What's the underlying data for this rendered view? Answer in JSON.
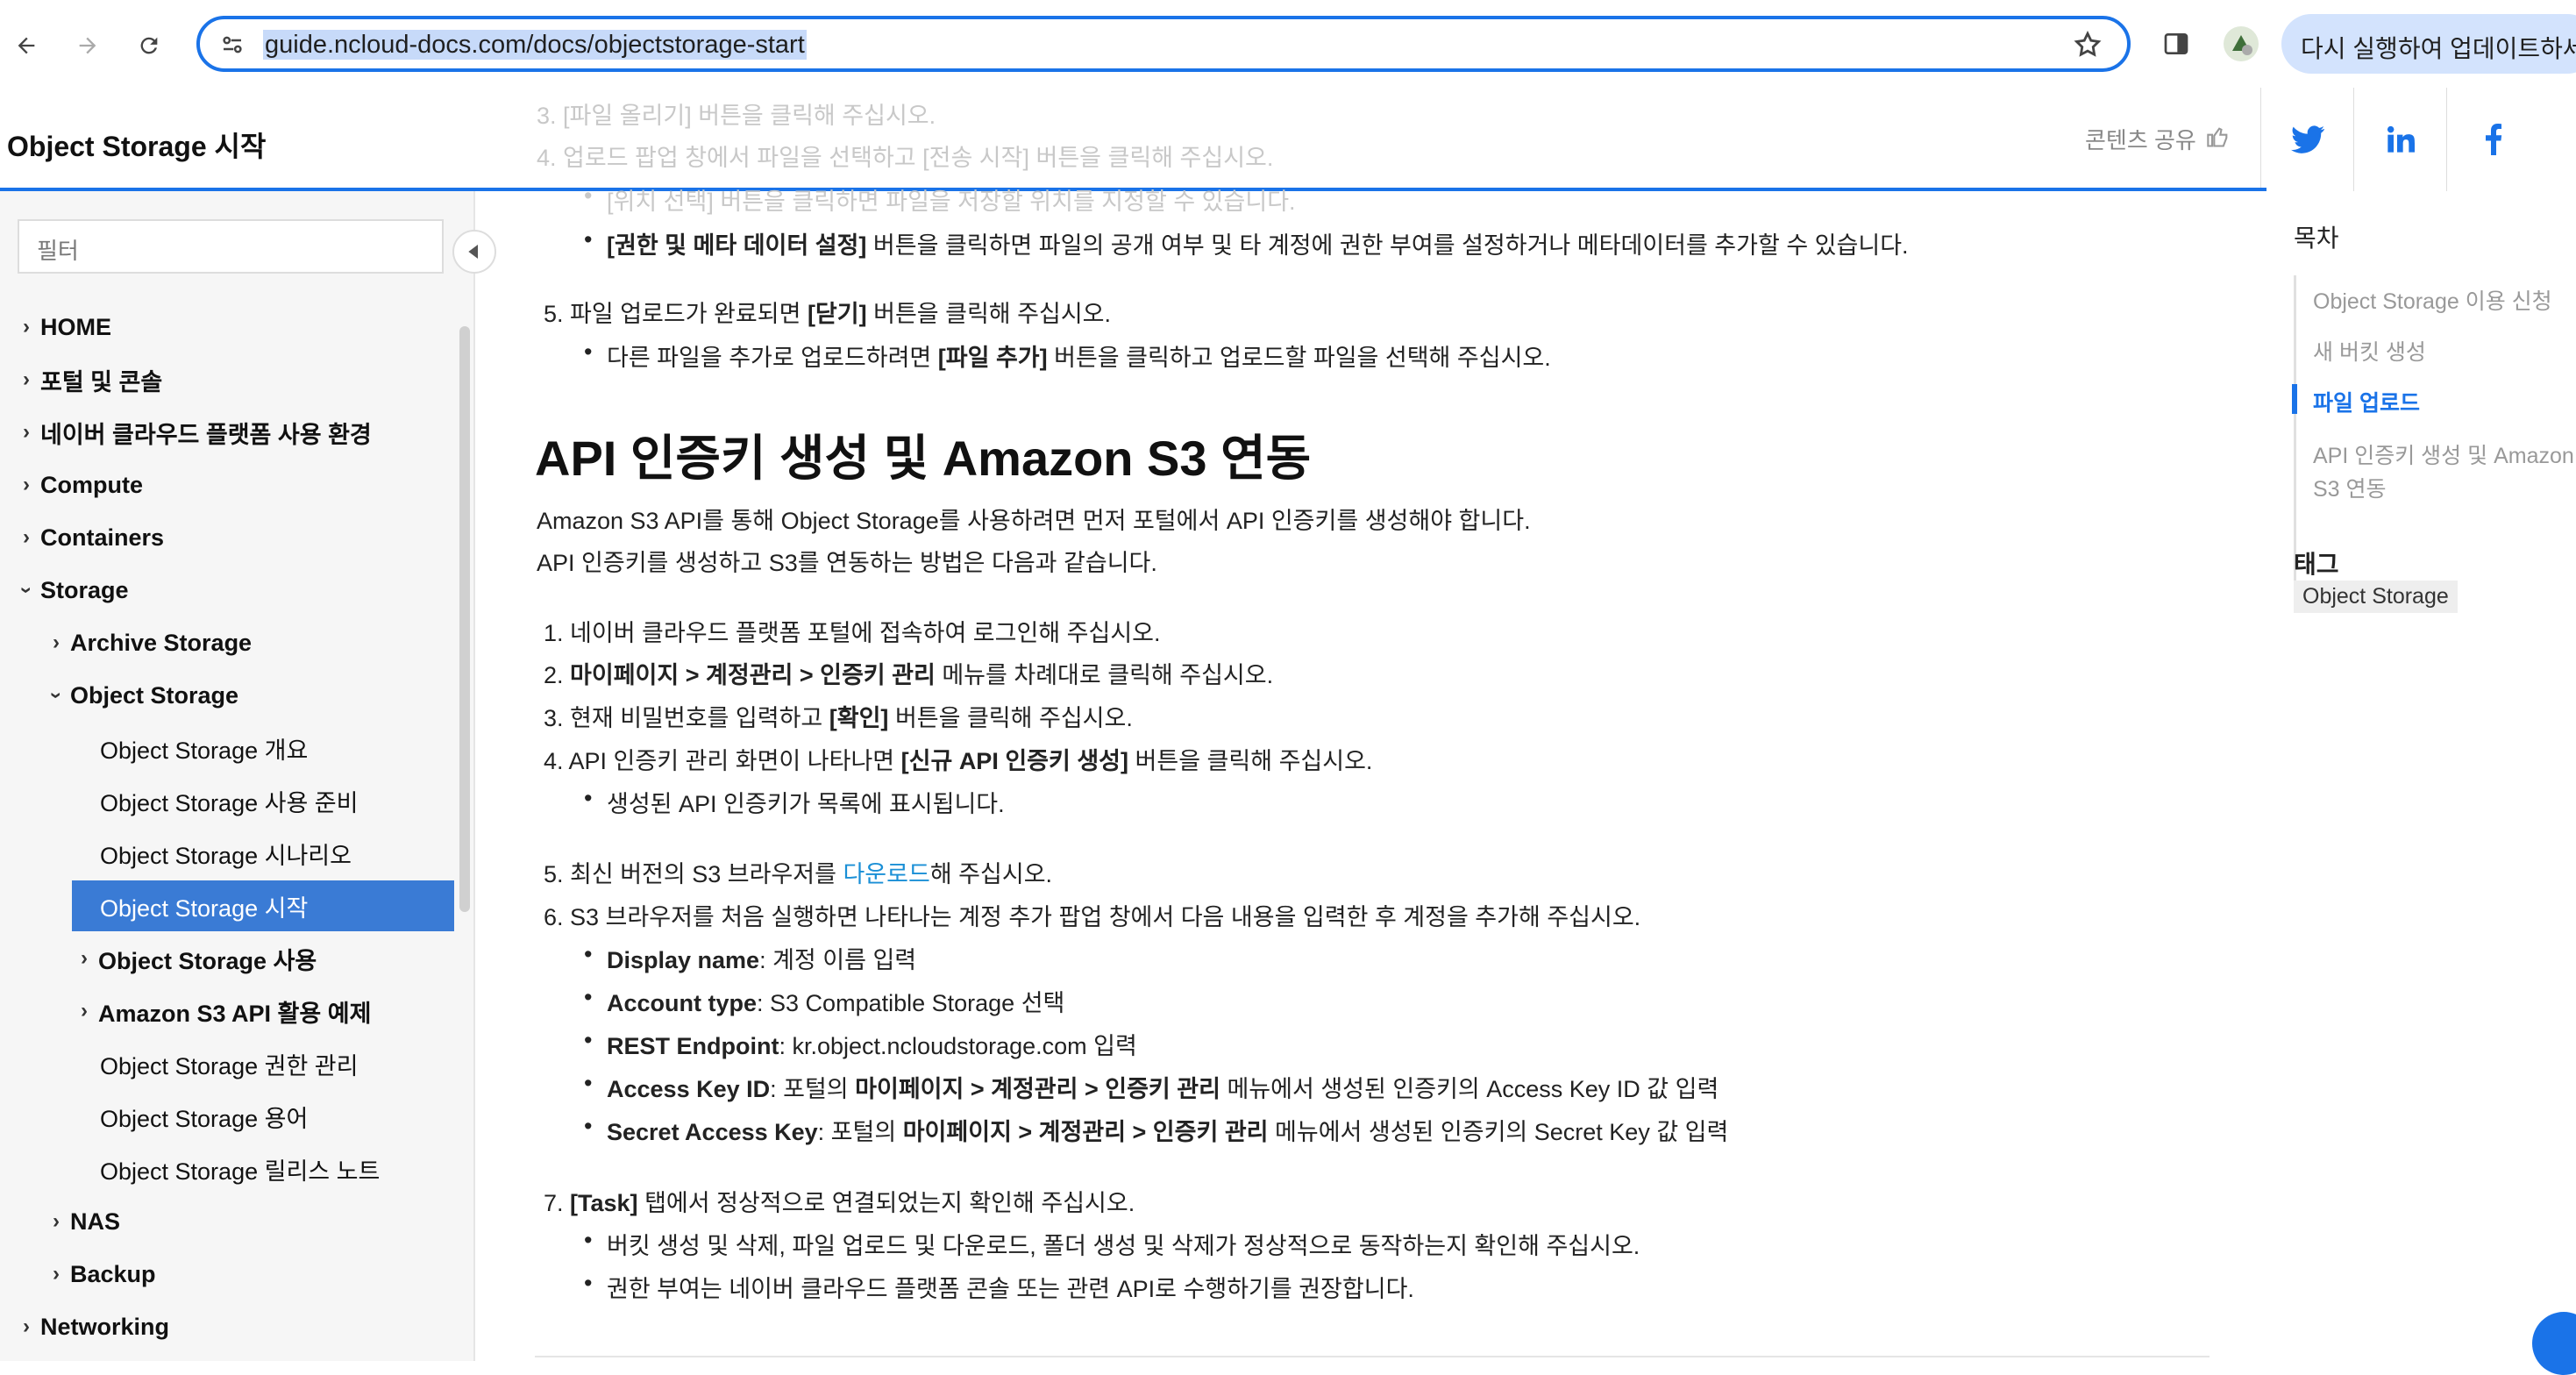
{
  "browser": {
    "url": "guide.ncloud-docs.com/docs/objectstorage-start",
    "update_button": "다시 실행하여 업데이트하세요.",
    "icons": [
      "back-arrow-icon",
      "forward-arrow-icon",
      "reload-icon",
      "site-info-icon",
      "star-icon",
      "side-panel-icon",
      "profile-avatar"
    ]
  },
  "header": {
    "title": "Object Storage 시작",
    "share_label": "콘텐츠 공유",
    "social": [
      "twitter-icon",
      "linkedin-icon",
      "facebook-icon"
    ]
  },
  "sidebar": {
    "filter_placeholder": "필터",
    "items": [
      {
        "label": "HOME",
        "level": 0,
        "chevron": "right"
      },
      {
        "label": "포털 및 콘솔",
        "level": 0,
        "chevron": "right"
      },
      {
        "label": "네이버 클라우드 플랫폼 사용 환경",
        "level": 0,
        "chevron": "right"
      },
      {
        "label": "Compute",
        "level": 0,
        "chevron": "right"
      },
      {
        "label": "Containers",
        "level": 0,
        "chevron": "right"
      },
      {
        "label": "Storage",
        "level": 0,
        "chevron": "down"
      },
      {
        "label": "Archive Storage",
        "level": 1,
        "chevron": "right"
      },
      {
        "label": "Object Storage",
        "level": 1,
        "chevron": "down"
      },
      {
        "label": "Object Storage 개요",
        "level": 2
      },
      {
        "label": "Object Storage 사용 준비",
        "level": 2
      },
      {
        "label": "Object Storage 시나리오",
        "level": 2
      },
      {
        "label": "Object Storage 시작",
        "level": 2,
        "active": true
      },
      {
        "label": "Object Storage 사용",
        "level": 2,
        "chevron": "right"
      },
      {
        "label": "Amazon S3 API 활용 예제",
        "level": 2,
        "chevron": "right"
      },
      {
        "label": "Object Storage 권한 관리",
        "level": 2
      },
      {
        "label": "Object Storage 용어",
        "level": 2
      },
      {
        "label": "Object Storage 릴리스 노트",
        "level": 2
      },
      {
        "label": "NAS",
        "level": 1,
        "chevron": "right"
      },
      {
        "label": "Backup",
        "level": 1,
        "chevron": "right"
      },
      {
        "label": "Networking",
        "level": 0,
        "chevron": "right"
      }
    ]
  },
  "content": {
    "faded": {
      "step3": "3. [파일 올리기] 버튼을 클릭해 주십시오.",
      "step4": "4. 업로드 팝업 창에서 파일을 선택하고 [전송 시작] 버튼을 클릭해 주십시오.",
      "partial": "[위치 선택] 버튼을 클릭하면 파일을 저장할 위치를 지정할 수 있습니다."
    },
    "perm_bullet_bold": "[권한 및 메타 데이터 설정]",
    "perm_bullet_rest": " 버튼을 클릭하면 파일의 공개 여부 및 타 계정에 권한 부여를 설정하거나 메타데이터를 추가할 수 있습니다.",
    "step5_a": "5. 파일 업로드가 완료되면 ",
    "step5_bold": "[닫기]",
    "step5_b": " 버튼을 클릭해 주십시오.",
    "step5_bullet_a": "다른 파일을 추가로 업로드하려면 ",
    "step5_bullet_bold": "[파일 추가]",
    "step5_bullet_b": " 버튼을 클릭하고 업로드할 파일을 선택해 주십시오.",
    "heading": "API 인증키 생성 및 Amazon S3 연동",
    "intro1": "Amazon S3 API를 통해 Object Storage를 사용하려면 먼저 포털에서 API 인증키를 생성해야 합니다.",
    "intro2": "API 인증키를 생성하고 S3를 연동하는 방법은 다음과 같습니다.",
    "s1": "1. 네이버 클라우드 플랫폼 포털에 접속하여 로그인해 주십시오.",
    "s2_a": "2. ",
    "s2_bold": "마이페이지 > 계정관리 > 인증키 관리",
    "s2_b": " 메뉴를 차례대로 클릭해 주십시오.",
    "s3_a": "3. 현재 비밀번호를 입력하고 ",
    "s3_bold": "[확인]",
    "s3_b": " 버튼을 클릭해 주십시오.",
    "s4_a": "4. API 인증키 관리 화면이 나타나면 ",
    "s4_bold": "[신규 API 인증키 생성]",
    "s4_b": " 버튼을 클릭해 주십시오.",
    "s4_bullet": "생성된 API 인증키가 목록에 표시됩니다.",
    "s5_a": "5. 최신 버전의 S3 브라우저를 ",
    "s5_link": "다운로드",
    "s5_b": "해 주십시오.",
    "s6": "6. S3 브라우저를 처음 실행하면 나타나는 계정 추가 팝업 창에서 다음 내용을 입력한 후 계정을 추가해 주십시오.",
    "fields": [
      {
        "bold": "Display name",
        "rest": ": 계정 이름 입력"
      },
      {
        "bold": "Account type",
        "rest": ": S3 Compatible Storage 선택"
      },
      {
        "bold": "REST Endpoint",
        "rest": ": kr.object.ncloudstorage.com 입력"
      }
    ],
    "ak_bold": "Access Key ID",
    "ak_a": ": 포털의 ",
    "ak_menu": "마이페이지 > 계정관리 > 인증키 관리",
    "ak_b": " 메뉴에서 생성된 인증키의 Access Key ID 값 입력",
    "sk_bold": "Secret Access Key",
    "sk_a": ": 포털의 ",
    "sk_menu": "마이페이지 > 계정관리 > 인증키 관리",
    "sk_b": " 메뉴에서 생성된 인증키의 Secret Key 값 입력",
    "s7_a": "7. ",
    "s7_bold": "[Task]",
    "s7_b": " 탭에서 정상적으로 연결되었는지 확인해 주십시오.",
    "s7_bullet1": "버킷 생성 및 삭제, 파일 업로드 및 다운로드, 폴더 생성 및 삭제가 정상적으로 동작하는지 확인해 주십시오.",
    "s7_bullet2": "권한 부여는 네이버 클라우드 플랫폼 콘솔 또는 관련 API로 수행하기를 권장합니다."
  },
  "toc": {
    "title": "목차",
    "items": [
      "Object Storage 이용 신청",
      "새 버킷 생성",
      "파일 업로드",
      "API 인증키 생성 및 Amazon",
      "S3 연동"
    ],
    "active_index": 2,
    "tags_title": "태그",
    "tag": "Object Storage"
  }
}
